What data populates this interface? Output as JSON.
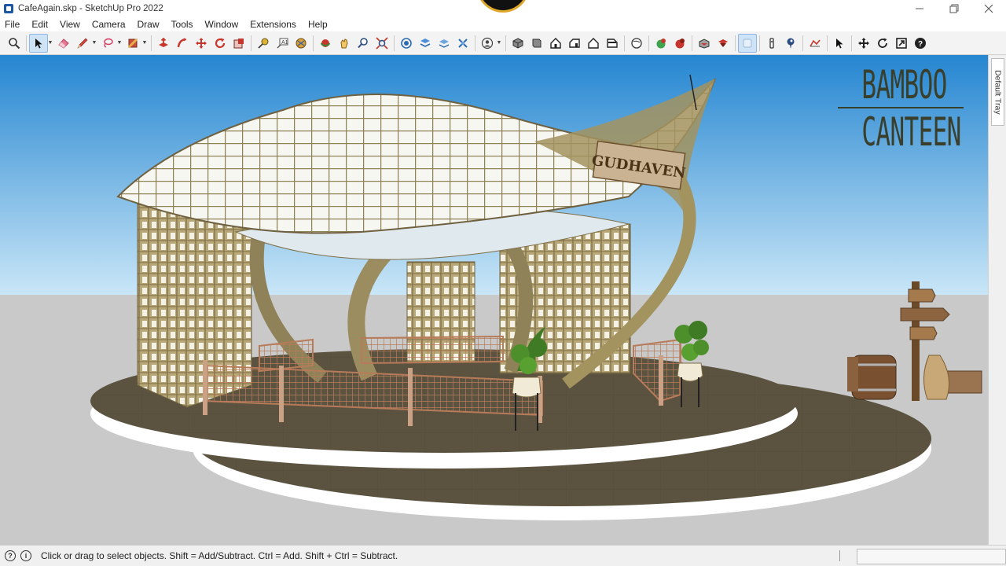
{
  "window": {
    "title": "CafeAgain.skp - SketchUp Pro 2022",
    "controls": [
      "minimize-icon",
      "restore-icon",
      "close-icon"
    ]
  },
  "menu": {
    "items": [
      "File",
      "Edit",
      "View",
      "Camera",
      "Draw",
      "Tools",
      "Window",
      "Extensions",
      "Help"
    ]
  },
  "toolbar": {
    "tools": [
      "zoom-icon",
      "select-icon",
      "eraser-icon",
      "pencil-line-icon",
      "lasso-icon",
      "paint-bucket-icon",
      "push-pull-icon",
      "follow-me-icon",
      "move-icon",
      "rotate-icon",
      "scale-icon",
      "tape-measure-icon",
      "text-icon",
      "section-plane-icon",
      "orbit-icon",
      "pan-icon",
      "zoom-window-icon",
      "zoom-extents-icon",
      "3d-warehouse-icon",
      "extension-warehouse-icon",
      "layout-icon",
      "styles-icon",
      "profile-icon",
      "iso-view-icon",
      "top-view-icon",
      "front-view-icon",
      "right-view-icon",
      "back-view-icon",
      "left-view-icon",
      "shaded-sphere-icon",
      "xray-icon",
      "hidden-line-icon",
      "solid-union-icon",
      "solid-subtract-icon",
      "display-mode-icon",
      "position-camera-icon",
      "look-around-icon",
      "sandbox-icon",
      "pointer-icon",
      "move-cross-icon",
      "refresh-icon",
      "export-icon",
      "help-icon"
    ]
  },
  "viewport": {
    "overlay_title": [
      "BAMBOO",
      "CANTEEN"
    ],
    "sign_text": "GUDHAVEN",
    "sky_color_top": "#2c8fd6",
    "sky_color_bottom": "#bfe3f7",
    "ground_color": "#c9c9c9",
    "platform_color": "#5b5340",
    "bamboo_color": "#b5a46f"
  },
  "tray": {
    "label": "Default Tray"
  },
  "statusbar": {
    "message": "Click or drag to select objects. Shift = Add/Subtract. Ctrl = Add. Shift + Ctrl = Subtract."
  }
}
